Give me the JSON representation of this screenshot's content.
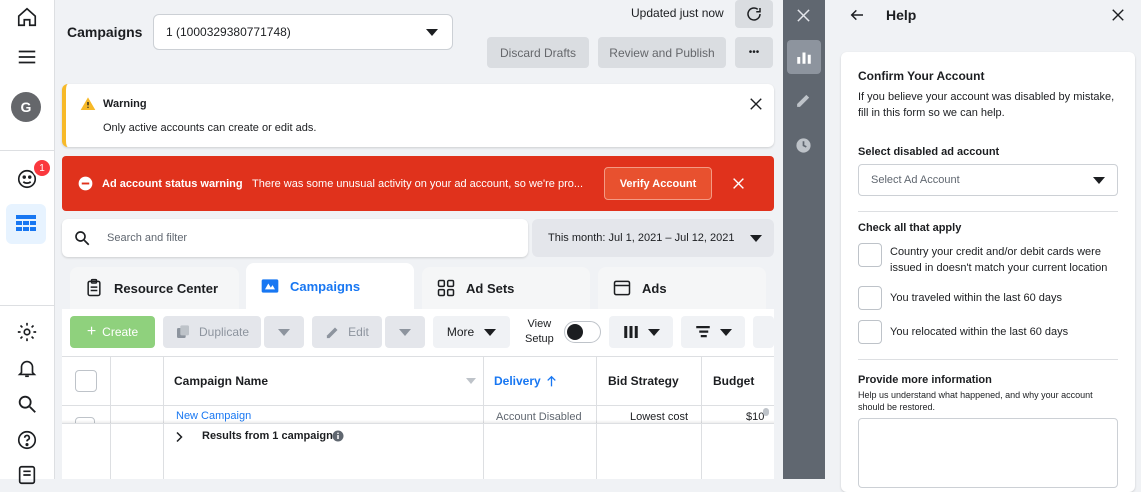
{
  "nav": {
    "avatar_letter": "G",
    "notification_count": "1"
  },
  "header": {
    "title": "Campaigns",
    "account_select": "1 (1000329380771748)",
    "updated": "Updated just now",
    "discard_label": "Discard Drafts",
    "review_label": "Review and Publish",
    "more_label": "•••"
  },
  "warning": {
    "title": "Warning",
    "message": "Only active accounts can create or edit ads."
  },
  "error_banner": {
    "title": "Ad account status warning",
    "message": "There was some unusual activity on your ad account, so we're pro...",
    "button_label": "Verify Account"
  },
  "search": {
    "placeholder": "Search and filter",
    "date_range": "This month: Jul 1, 2021 – Jul 12, 2021"
  },
  "tabs": [
    {
      "label": "Resource Center"
    },
    {
      "label": "Campaigns"
    },
    {
      "label": "Ad Sets"
    },
    {
      "label": "Ads"
    }
  ],
  "toolbar": {
    "create_label": "Create",
    "duplicate_label": "Duplicate",
    "edit_label": "Edit",
    "more_label": "More",
    "view_setup_label_1": "View",
    "view_setup_label_2": "Setup"
  },
  "table": {
    "headers": {
      "name": "Campaign Name",
      "delivery": "Delivery",
      "bid": "Bid Strategy",
      "budget": "Budget"
    },
    "row": {
      "name": "New Campaign",
      "delivery": "Account Disabled",
      "bid": "Lowest cost",
      "budget": "$10"
    },
    "results": "Results from 1 campaign"
  },
  "help": {
    "title": "Help",
    "card_title": "Confirm Your Account",
    "card_intro": "If you believe your account was disabled by mistake, fill in this form so we can help.",
    "select_label": "Select disabled ad account",
    "select_placeholder": "Select Ad Account",
    "check_label": "Check all that apply",
    "options": [
      {
        "label": "Country your credit and/or debit cards were issued in doesn't match your current location"
      },
      {
        "label": "You traveled within the last 60 days"
      },
      {
        "label": "You relocated within the last 60 days"
      }
    ],
    "more_info_label": "Provide more information",
    "more_info_help": "Help us understand what happened, and why your account should be restored."
  },
  "colors": {
    "brand_blue": "#1877f2",
    "error_red": "#e0321c",
    "warning_yellow": "#f7b928",
    "create_green": "#8fd17d"
  }
}
